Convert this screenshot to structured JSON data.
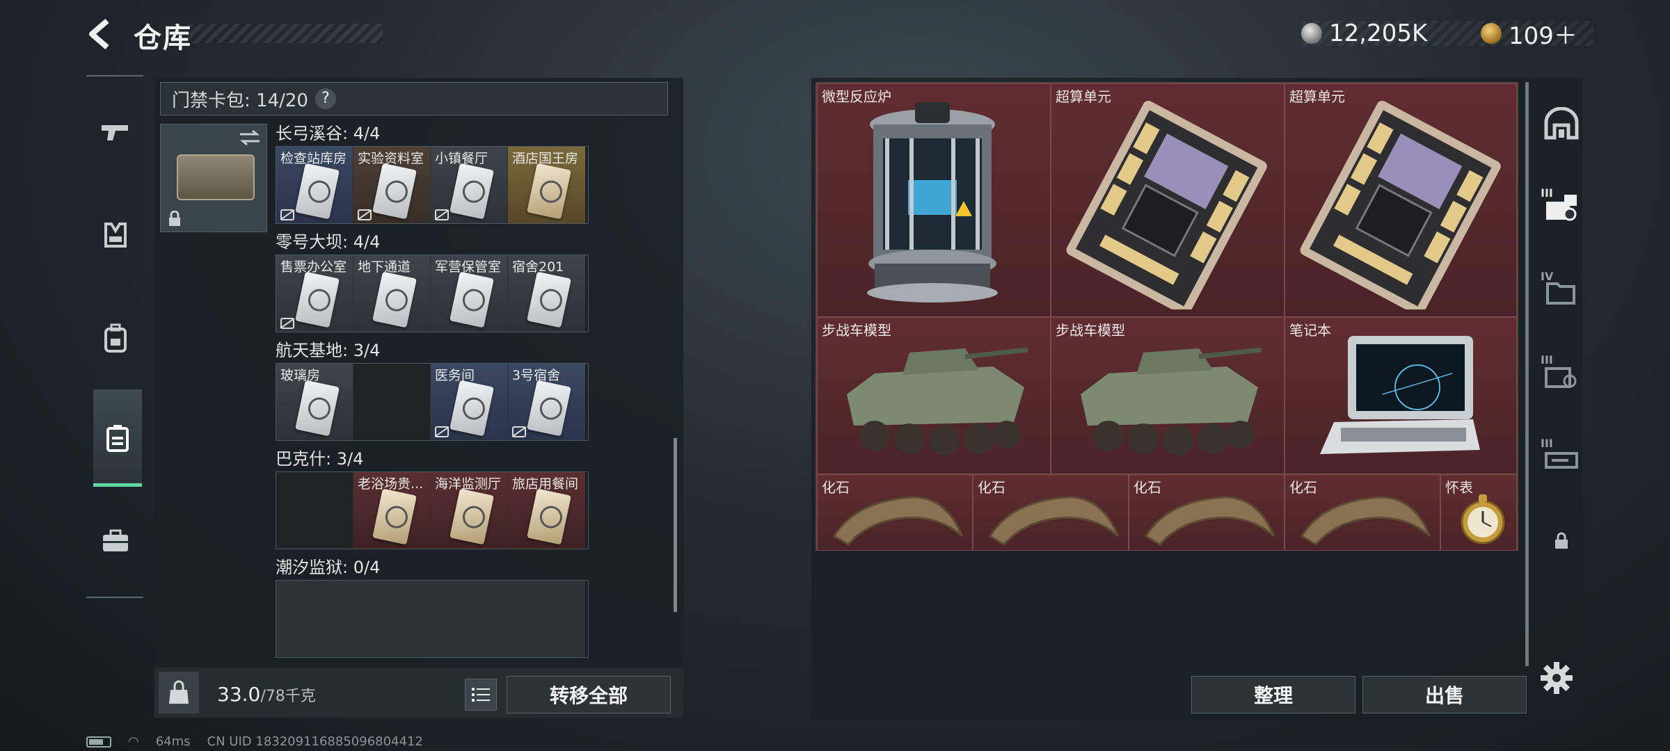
{
  "header": {
    "title": "仓库",
    "currency_silver": "12,205K",
    "currency_gold": "109＋"
  },
  "keycard_panel": {
    "pack_label": "门禁卡包: 14/20",
    "help": "?",
    "sections": [
      {
        "name": "长弓溪谷: 4/4",
        "slots": [
          {
            "label": "检查站库房",
            "style": "blue",
            "card": true,
            "unbound": true
          },
          {
            "label": "实验资料室",
            "style": "brown",
            "card": true,
            "unbound": true
          },
          {
            "label": "小镇餐厅",
            "style": "gray",
            "card": true,
            "unbound": true
          },
          {
            "label": "酒店国王房",
            "style": "gold",
            "card": true,
            "unbound": false
          }
        ]
      },
      {
        "name": "零号大坝: 4/4",
        "slots": [
          {
            "label": "售票办公室",
            "style": "gray",
            "card": true,
            "unbound": true
          },
          {
            "label": "地下通道",
            "style": "gray",
            "card": true,
            "unbound": false
          },
          {
            "label": "军营保管室",
            "style": "gray",
            "card": true,
            "unbound": false
          },
          {
            "label": "宿舍201",
            "style": "gray",
            "card": true,
            "unbound": false
          }
        ]
      },
      {
        "name": "航天基地: 3/4",
        "slots": [
          {
            "label": "玻璃房",
            "style": "gray",
            "card": true,
            "unbound": false
          },
          {
            "label": "",
            "style": "dark",
            "card": false,
            "unbound": false
          },
          {
            "label": "医务间",
            "style": "blue",
            "card": true,
            "unbound": true
          },
          {
            "label": "3号宿舍",
            "style": "blue",
            "card": true,
            "unbound": true
          }
        ]
      },
      {
        "name": "巴克什: 3/4",
        "slots": [
          {
            "label": "",
            "style": "dark",
            "card": false,
            "unbound": false
          },
          {
            "label": "老浴场贵...",
            "style": "red",
            "card": true,
            "unbound": false
          },
          {
            "label": "海洋监测厅",
            "style": "red",
            "card": true,
            "unbound": false
          },
          {
            "label": "旅店用餐间",
            "style": "red",
            "card": true,
            "unbound": false
          }
        ]
      },
      {
        "name": "潮汐监狱: 0/4",
        "slots": [
          {
            "label": "",
            "style": "empty",
            "card": false,
            "unbound": false
          },
          {
            "label": "",
            "style": "empty",
            "card": false,
            "unbound": false
          },
          {
            "label": "",
            "style": "empty",
            "card": false,
            "unbound": false
          },
          {
            "label": "",
            "style": "empty",
            "card": false,
            "unbound": false
          }
        ]
      }
    ]
  },
  "left_footer": {
    "weight_current": "33.0",
    "weight_max": "/78千克",
    "transfer_all": "转移全部"
  },
  "stash_items": [
    {
      "label": "微型反应炉",
      "icon": "reactor-icon"
    },
    {
      "label": "超算单元",
      "icon": "circuit-board-icon"
    },
    {
      "label": "超算单元",
      "icon": "circuit-board-icon"
    },
    {
      "label": "步战车模型",
      "icon": "ifv-model-icon"
    },
    {
      "label": "步战车模型",
      "icon": "ifv-model-icon"
    },
    {
      "label": "笔记本",
      "icon": "laptop-icon"
    },
    {
      "label": "化石",
      "icon": "fossil-claw-icon"
    },
    {
      "label": "化石",
      "icon": "fossil-claw-icon"
    },
    {
      "label": "化石",
      "icon": "fossil-claw-icon"
    },
    {
      "label": "化石",
      "icon": "fossil-claw-icon"
    },
    {
      "label": "怀表",
      "icon": "pocket-watch-icon"
    }
  ],
  "right_footer": {
    "sort": "整理",
    "sell": "出售"
  },
  "right_nav": {
    "tabs": [
      "",
      "III",
      "IV",
      "III",
      "III"
    ]
  },
  "status_bar": {
    "ping": "64ms",
    "uid": "CN UID 183209116885096804412"
  }
}
